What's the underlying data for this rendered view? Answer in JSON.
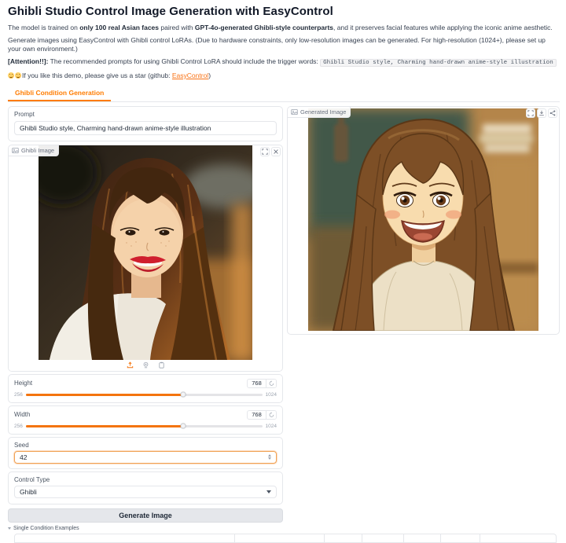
{
  "header": {
    "title": "Ghibli Studio Control Image Generation with EasyControl",
    "p1": {
      "t1": "The model is trained on ",
      "b1": "only 100 real Asian faces",
      "t2": " paired with ",
      "b2": "GPT-4o-generated Ghibli-style counterparts",
      "t3": ", and it preserves facial features while applying the iconic anime aesthetic."
    },
    "p2": "Generate images using EasyControl with Ghibli control LoRAs.  (Due to hardware constraints, only low-resolution images can be generated. For high-resolution (1024+), please set up your own environment.)",
    "p3": {
      "b1": "[Attention!!]:",
      "t1": "  The recommended prompts for using Ghibli Control LoRA should include the trigger words: ",
      "code": "Ghibli Studio style, Charming hand-drawn anime-style illustration"
    },
    "p4": {
      "t1": "If you like this demo, please give us a star (github: ",
      "link": "EasyControl",
      "t2": ")"
    }
  },
  "tabs": {
    "active": "Ghibli Condition Generation"
  },
  "prompt": {
    "label": "Prompt",
    "value": "Ghibli Studio style, Charming hand-drawn anime-style illustration"
  },
  "source_panel": {
    "label": "Ghibli Image"
  },
  "output_panel": {
    "label": "Generated Image"
  },
  "sliders": {
    "height": {
      "label": "Height",
      "value": "768",
      "min": "256",
      "max": "1024"
    },
    "width": {
      "label": "Width",
      "value": "768",
      "min": "256",
      "max": "1024"
    }
  },
  "seed": {
    "label": "Seed",
    "value": "42"
  },
  "control_type": {
    "label": "Control Type",
    "value": "Ghibli"
  },
  "generate": {
    "label": "Generate Image"
  },
  "examples": {
    "label": "Single Condition Examples"
  },
  "icons": {
    "source_chip": "image-icon",
    "output_chip": "image-icon",
    "corner_left": [
      "fullscreen-icon",
      "close-icon"
    ],
    "corner_right": [
      "fullscreen-icon",
      "download-icon",
      "share-icon"
    ],
    "source_toolbar": [
      "upload-icon",
      "webcam-icon",
      "clipboard-icon"
    ]
  },
  "colors": {
    "accent_orange": "#f4740e",
    "border": "#e5e7eb",
    "slider_track": "#e4e4e7"
  }
}
